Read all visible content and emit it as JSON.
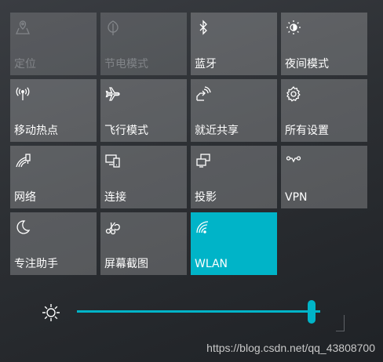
{
  "tiles": [
    {
      "label": "定位",
      "icon": "location-icon",
      "state": "disabled"
    },
    {
      "label": "节电模式",
      "icon": "battery-saver-icon",
      "state": "disabled"
    },
    {
      "label": "蓝牙",
      "icon": "bluetooth-icon",
      "state": "normal"
    },
    {
      "label": "夜间模式",
      "icon": "night-light-icon",
      "state": "normal"
    },
    {
      "label": "移动热点",
      "icon": "mobile-hotspot-icon",
      "state": "normal"
    },
    {
      "label": "飞行模式",
      "icon": "airplane-icon",
      "state": "normal"
    },
    {
      "label": "就近共享",
      "icon": "nearby-share-icon",
      "state": "normal"
    },
    {
      "label": "所有设置",
      "icon": "gear-icon",
      "state": "normal"
    },
    {
      "label": "网络",
      "icon": "network-icon",
      "state": "normal"
    },
    {
      "label": "连接",
      "icon": "connect-icon",
      "state": "normal"
    },
    {
      "label": "投影",
      "icon": "project-icon",
      "state": "normal"
    },
    {
      "label": "VPN",
      "icon": "vpn-icon",
      "state": "normal"
    },
    {
      "label": "专注助手",
      "icon": "moon-icon",
      "state": "normal"
    },
    {
      "label": "屏幕截图",
      "icon": "screen-snip-icon",
      "state": "normal"
    },
    {
      "label": "WLAN",
      "icon": "wifi-icon",
      "state": "active"
    }
  ],
  "brightness": {
    "icon": "brightness-icon",
    "level": 0.98
  },
  "colors": {
    "accent": "#00b4c8",
    "tile": "#5a5d61",
    "background": "#2c2f33"
  },
  "watermark": "https://blog.csdn.net/qq_43808700"
}
